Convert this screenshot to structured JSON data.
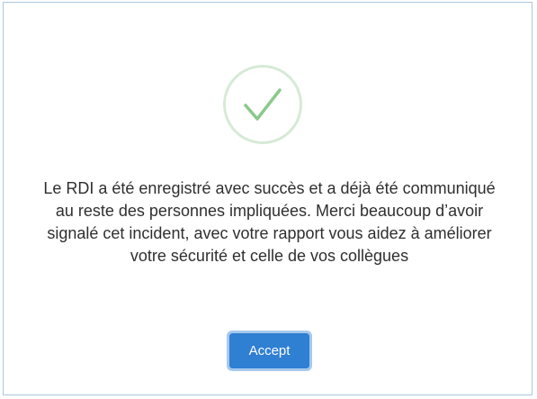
{
  "dialog": {
    "icon": "checkmark-icon",
    "icon_color": "#8bc98b",
    "message": "Le RDI a été enregistré avec succès et a déjà été communiqué au reste des personnes impliquées. Merci beaucoup d’avoir signalé cet incident, avec votre rapport vous aidez à améliorer votre sécurité et celle de vos collègues",
    "accept_label": "Accept",
    "accent_color": "#2f7fd3"
  }
}
